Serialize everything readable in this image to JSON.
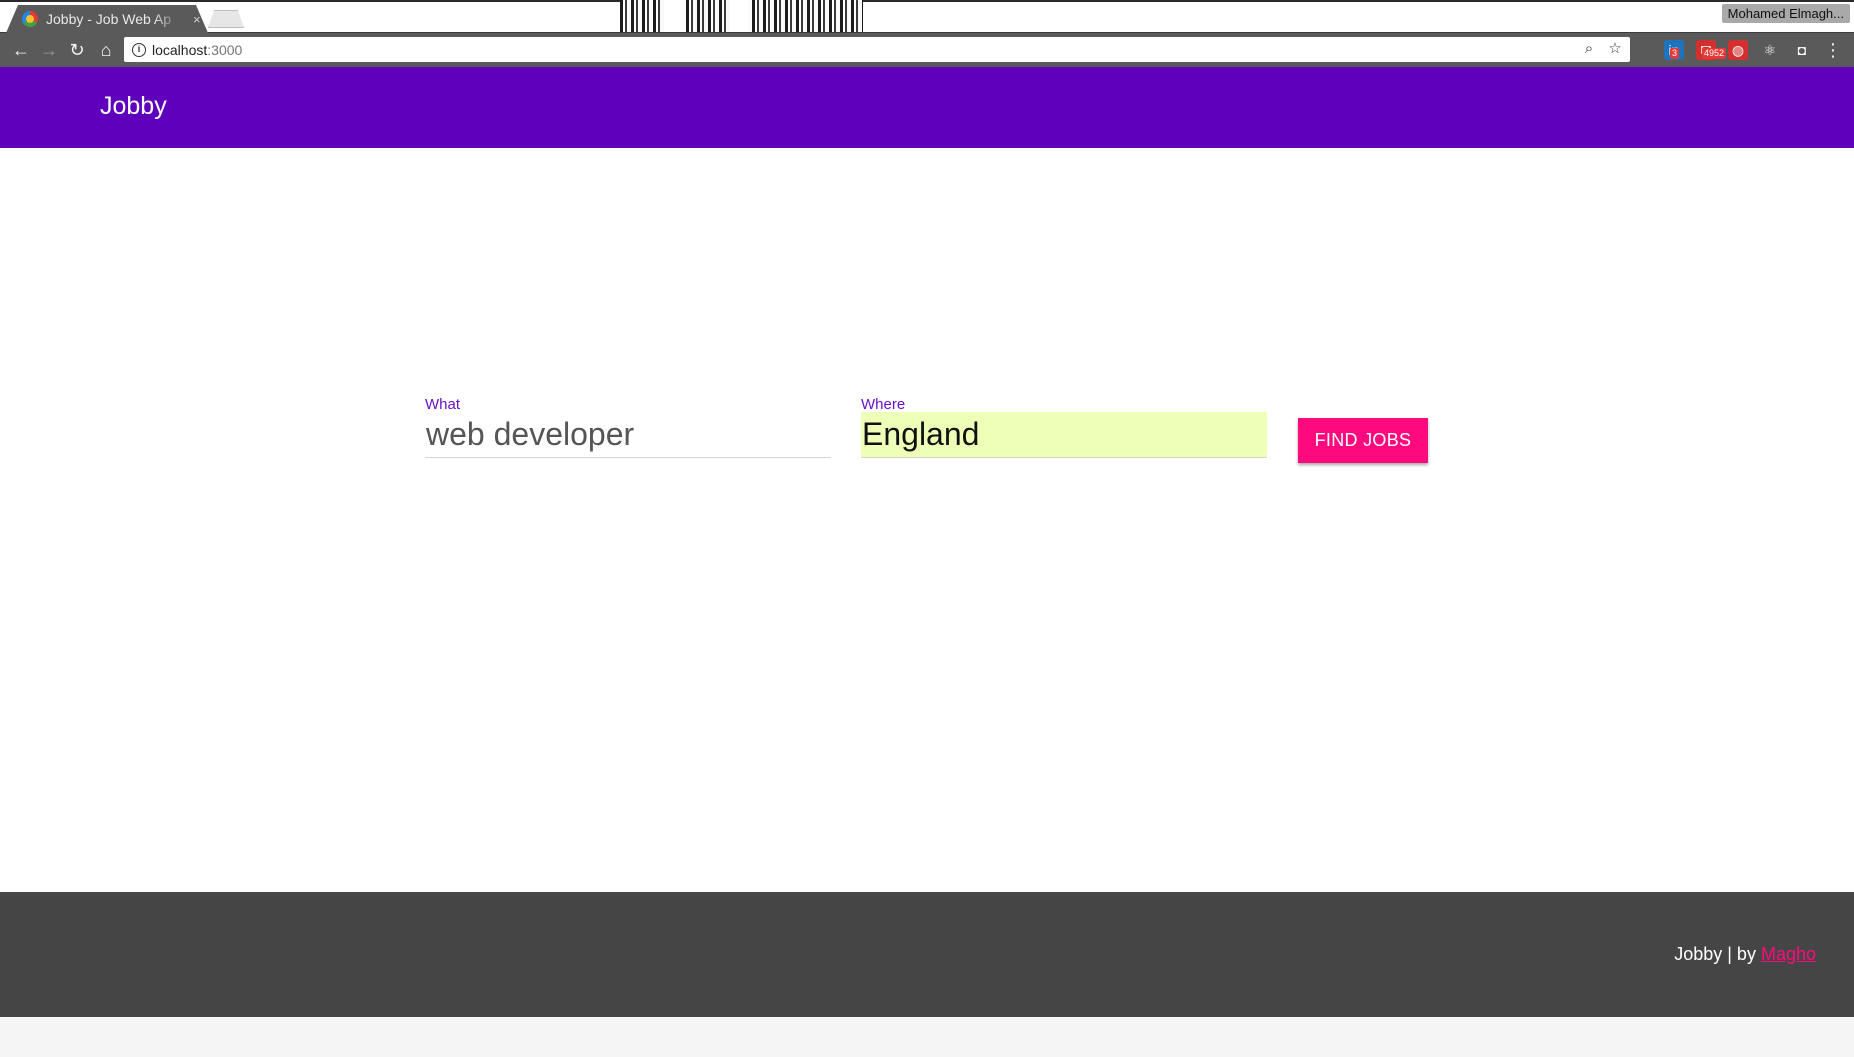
{
  "browser": {
    "tab_title": "Jobby - Job Web Ap",
    "tab_close": "×",
    "profile_name": "Mohamed Elmagh...",
    "url_host": "localhost",
    "url_port": ":3000",
    "icons": {
      "back": "←",
      "forward": "→",
      "reload": "↻",
      "home": "⌂",
      "info": "i",
      "zoom": "⌕",
      "bookmark": "☆",
      "menu": "⋮"
    },
    "extensions": [
      {
        "name": "linkedin-extension",
        "glyph": "in",
        "badge": "3",
        "color": "#1e73be"
      },
      {
        "name": "gmail-extension",
        "glyph": "✉",
        "badge": "4952",
        "color": "#d32f2f"
      },
      {
        "name": "adblock-extension",
        "glyph": "◍",
        "badge": "",
        "color": "#d32f2f"
      },
      {
        "name": "react-devtools-extension",
        "glyph": "⚛",
        "badge": "",
        "color": "#5a5a5a"
      },
      {
        "name": "screenshot-extension",
        "glyph": "◘",
        "badge": "",
        "color": "#5a5a5a"
      }
    ]
  },
  "app": {
    "brand": "Jobby",
    "colors": {
      "header": "#5e00bc",
      "accent": "#ff0a7e",
      "label": "#6a12c9",
      "footer": "#454545"
    }
  },
  "search": {
    "what_label": "What",
    "what_value": "web developer",
    "where_label": "Where",
    "where_value": "England",
    "button_label": "FIND JOBS"
  },
  "footer": {
    "text": "Jobby | by ",
    "link_text": "Magho"
  }
}
